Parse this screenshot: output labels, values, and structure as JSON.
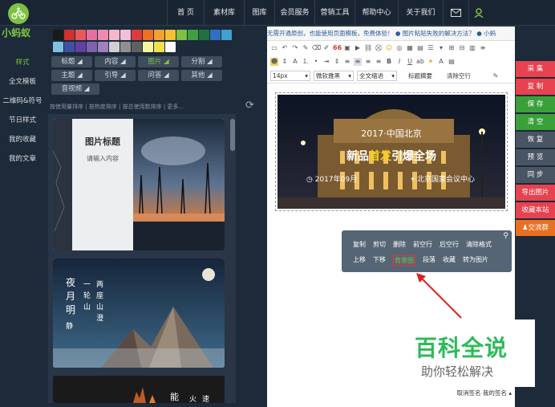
{
  "brand": {
    "name": "小蚂蚁",
    "color": "#7cc242"
  },
  "nav": {
    "items": [
      "首 页",
      "素材库",
      "图库",
      "会员服务",
      "营销工具",
      "帮助中心",
      "关于我们"
    ],
    "icons": [
      "mail-icon",
      "user-icon"
    ]
  },
  "sidebar": {
    "items": [
      "样式",
      "全文模板",
      "二维码&符号",
      "节日样式",
      "我的收藏",
      "我的文章"
    ],
    "active": 0
  },
  "swatches": [
    "#1a1a1a",
    "#d03030",
    "#e85a5a",
    "#e870a0",
    "#f08ab0",
    "#f5b8c8",
    "#f0c0d8",
    "#e03a3a",
    "#f07020",
    "#f5a030",
    "#f5c030",
    "#80c040",
    "#40a040",
    "#207040",
    "#3070c0",
    "#40a0d0",
    "#80c0e0",
    "#4050a0",
    "#6040a0",
    "#8060b0",
    "#a080c0",
    "#d0d0d0",
    "#909090",
    "#606060",
    "#f5f5a0",
    "#f0e050",
    "#ffffff"
  ],
  "categories": [
    "标题",
    "内容",
    "图片",
    "分割",
    "主题",
    "引导",
    "问答",
    "其他",
    "音视频"
  ],
  "active_category": "图片",
  "sort_bar": "按使用量排序  |  按热度排序  |  按总使用数排序  |  更多...",
  "templates": {
    "card1": {
      "title": "图片标题",
      "subtitle": "请输入内容"
    },
    "card2": {
      "v1": "夜",
      "v2": "月",
      "v3": "明",
      "v4": "静",
      "c1": "一",
      "c2": "轮",
      "c3": "山",
      "c4": "两",
      "c5": "座",
      "c6": "山",
      "c7": "澄"
    },
    "card3": {
      "t1": "能",
      "t2": "火",
      "t3": "速"
    }
  },
  "editor": {
    "notice": "无需开通原创，也能使用页面模板，免费体验！   ●   图片粘贴失败的解决方法？   ●   小蚂",
    "font_size": "14px",
    "font_family": "微软雅黑",
    "indent": "全文缩进",
    "summary_btn": "标题摘要",
    "clear_btn": "清除空行",
    "banner": {
      "year_city": "2017·中国北京",
      "headline_pre": "新品",
      "headline_hl": "首发",
      "headline_post": "引爆全场",
      "date": "2017年09月",
      "venue": "北京国家会议中心"
    },
    "bottom": "取消签名 我的签名 ▴"
  },
  "context_menu": {
    "row1": [
      "复制",
      "剪切",
      "删除",
      "前空行",
      "后空行",
      "清除格式"
    ],
    "row2": [
      "上移",
      "下移",
      "背景图",
      "段落",
      "收藏",
      "转为图片"
    ],
    "highlight": "背景图"
  },
  "right_buttons": [
    {
      "label": "采 集",
      "color": "#e8414f"
    },
    {
      "label": "复 制",
      "color": "#e8414f"
    },
    {
      "label": "保 存",
      "color": "#3aa03a"
    },
    {
      "label": "清 空",
      "color": "#3aa03a"
    },
    {
      "label": "恢 复",
      "color": "#4a5563"
    },
    {
      "label": "预 览",
      "color": "#4a5563"
    },
    {
      "label": "同 步",
      "color": "#4a5563"
    },
    {
      "label": "导出图片",
      "color": "#e8414f"
    },
    {
      "label": "收藏本站",
      "color": "#e8414f"
    },
    {
      "label": "交流群",
      "color": "#e87020"
    }
  ],
  "watermark": {
    "title": "百科全说",
    "subtitle": "助你轻松解决",
    "color": "#2dbb5a"
  }
}
